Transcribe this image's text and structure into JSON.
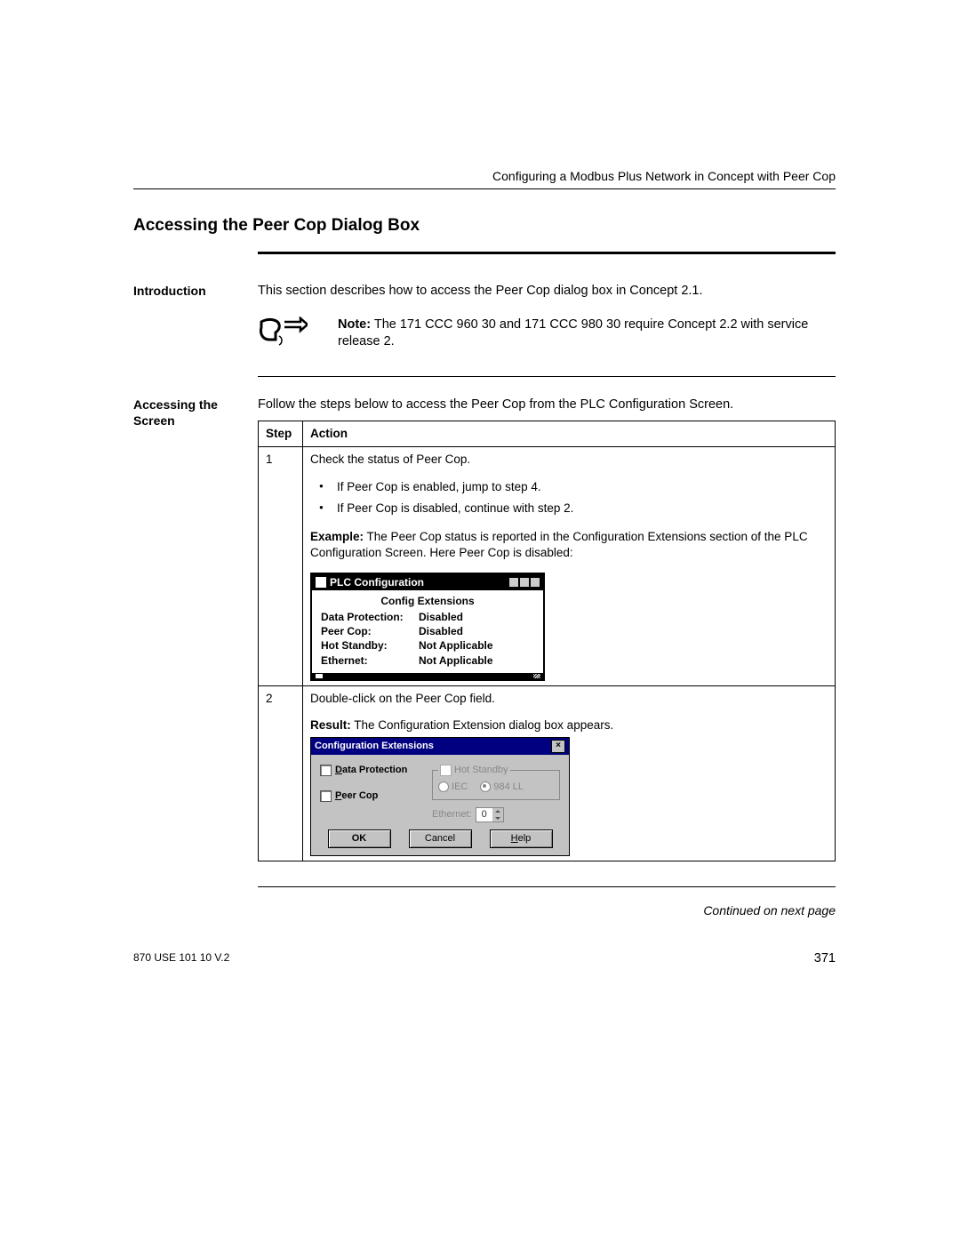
{
  "header": {
    "chapter": "Configuring a Modbus Plus Network in Concept with Peer Cop"
  },
  "title": "Accessing the Peer Cop Dialog Box",
  "intro": {
    "sidehead": "Introduction",
    "text": "This section describes how to access the Peer Cop dialog box in Concept 2.1.",
    "note_label": "Note:",
    "note_text": "The 171 CCC 960 30 and 171 CCC 980 30 require Concept 2.2 with service release 2."
  },
  "access": {
    "sidehead": "Accessing the Screen",
    "lead": "Follow the steps below to access the Peer Cop from the PLC Configuration Screen.",
    "table": {
      "col_step": "Step",
      "col_action": "Action",
      "step1": {
        "num": "1",
        "line1": "Check the status of Peer Cop.",
        "bullet1": "If Peer Cop is enabled, jump to step 4.",
        "bullet2": "If Peer Cop is disabled, continue with step 2.",
        "example_label": "Example:",
        "example_text": "The Peer Cop status is reported in the Configuration Extensions section of the PLC Configuration Screen. Here Peer Cop is disabled:"
      },
      "step2": {
        "num": "2",
        "line1": "Double-click on the Peer Cop field.",
        "result_label": "Result:",
        "result_text": "The Configuration Extension dialog box appears."
      }
    }
  },
  "plc_window": {
    "title": "PLC Configuration",
    "subtitle": "Config Extensions",
    "rows": [
      {
        "k": "Data Protection:",
        "v": "Disabled"
      },
      {
        "k": "Peer Cop:",
        "v": "Disabled"
      },
      {
        "k": "Hot Standby:",
        "v": "Not Applicable"
      },
      {
        "k": "Ethernet:",
        "v": "Not Applicable"
      }
    ]
  },
  "dlg": {
    "title": "Configuration Extensions",
    "data_protection_u": "D",
    "data_protection_rest": "ata Protection",
    "peer_cop_u": "P",
    "peer_cop_rest": "eer Cop",
    "hot_standby_label": "Hot ",
    "hot_standby_u": "S",
    "hot_standby_rest": "tandby",
    "radio_iec_u": "I",
    "radio_iec_rest": "EC",
    "radio_984_u": "9",
    "radio_984_rest": "84 LL",
    "ethernet_u": "E",
    "ethernet_rest": "thernet:",
    "ethernet_value": "0",
    "btn_ok": "OK",
    "btn_cancel": "Cancel",
    "btn_help_u": "H",
    "btn_help_rest": "elp"
  },
  "continued": "Continued on next page",
  "footer": {
    "doc": "870 USE 101 10 V.2",
    "page": "371"
  }
}
